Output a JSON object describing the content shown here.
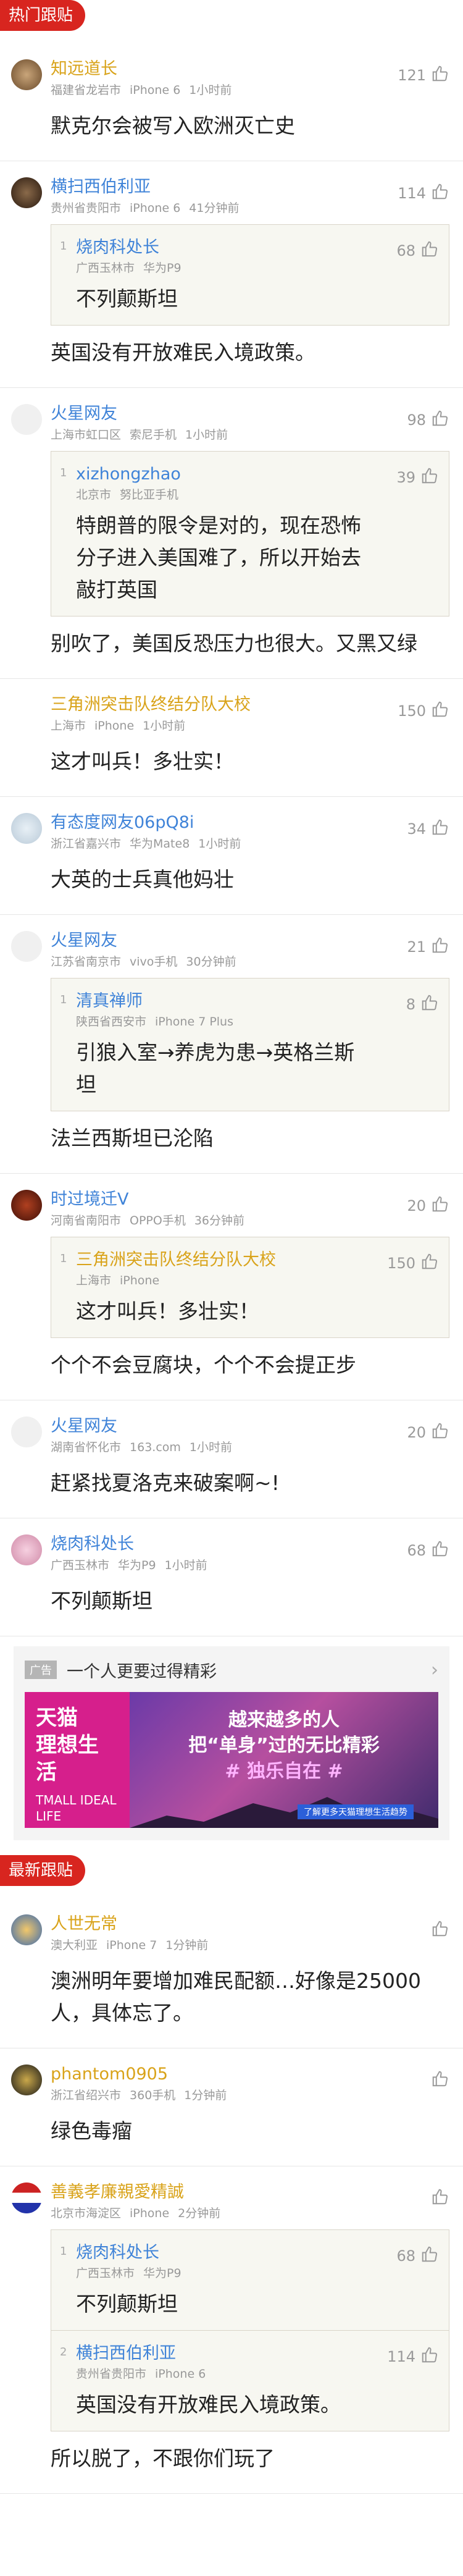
{
  "sections": {
    "hot": "热门跟贴",
    "latest": "最新跟贴"
  },
  "comments": [
    {
      "name": "知远道长",
      "meta": [
        "福建省龙岩市",
        "iPhone 6",
        "1小时前"
      ],
      "likes": "121",
      "text": "默克尔会被写入欧洲灭亡史"
    },
    {
      "name": "横扫西伯利亚",
      "meta": [
        "贵州省贵阳市",
        "iPhone 6",
        "41分钟前"
      ],
      "likes": "114",
      "quote": [
        {
          "num": "1",
          "name": "烧肉科处长",
          "meta": [
            "广西玉林市",
            "华为P9"
          ],
          "likes": "68",
          "text": "不列颠斯坦"
        }
      ],
      "text": "英国没有开放难民入境政策。"
    },
    {
      "name": "火星网友",
      "meta": [
        "上海市虹口区",
        "索尼手机",
        "1小时前"
      ],
      "likes": "98",
      "quote": [
        {
          "num": "1",
          "name": "xizhongzhao",
          "meta": [
            "北京市",
            "努比亚手机"
          ],
          "likes": "39",
          "text": "特朗普的限令是对的，现在恐怖分子进入美国难了，所以开始去敲打英国"
        }
      ],
      "text": "别吹了，美国反恐压力也很大。又黑又绿"
    },
    {
      "name": "三角洲突击队终结分队大校",
      "meta": [
        "上海市",
        "iPhone",
        "1小时前"
      ],
      "likes": "150",
      "text": "这才叫兵！多壮实！"
    },
    {
      "name": "有态度网友06pQ8i",
      "meta": [
        "浙江省嘉兴市",
        "华为Mate8",
        "1小时前"
      ],
      "likes": "34",
      "text": "大英的士兵真他妈壮"
    },
    {
      "name": "火星网友",
      "meta": [
        "江苏省南京市",
        "vivo手机",
        "30分钟前"
      ],
      "likes": "21",
      "quote": [
        {
          "num": "1",
          "name": "清真禅师",
          "meta": [
            "陕西省西安市",
            "iPhone 7 Plus"
          ],
          "likes": "8",
          "text": "引狼入室→养虎为患→英格兰斯坦"
        }
      ],
      "text": "法兰西斯坦已沦陷"
    },
    {
      "name": "时过境迁V",
      "meta": [
        "河南省南阳市",
        "OPPO手机",
        "36分钟前"
      ],
      "likes": "20",
      "quote": [
        {
          "num": "1",
          "name": "三角洲突击队终结分队大校",
          "meta": [
            "上海市",
            "iPhone"
          ],
          "likes": "150",
          "text": "这才叫兵！多壮实！"
        }
      ],
      "text": "个个不会豆腐块，个个不会提正步"
    },
    {
      "name": "火星网友",
      "meta": [
        "湖南省怀化市",
        "163.com",
        "1小时前"
      ],
      "likes": "20",
      "text": "赶紧找夏洛克来破案啊~!"
    },
    {
      "name": "烧肉科处长",
      "meta": [
        "广西玉林市",
        "华为P9",
        "1小时前"
      ],
      "likes": "68",
      "text": "不列颠斯坦"
    }
  ],
  "ad": {
    "tag": "广告",
    "title": "一个人更要过得精彩",
    "left_l1": "天猫\n理想生活",
    "left_l2": "TMALL IDEAL LIFE",
    "r1": "越来越多的人",
    "r2": "把“单身”过的无比精彩",
    "r3": "# 独乐自在 #",
    "r4": "了解更多天猫理想生活趋势"
  },
  "latest": [
    {
      "name": "人世无常",
      "meta": [
        "澳大利亚",
        "iPhone 7",
        "1分钟前"
      ],
      "text": "澳洲明年要增加难民配额…好像是25000人，具体忘了。"
    },
    {
      "name": "phantom0905",
      "meta": [
        "浙江省绍兴市",
        "360手机",
        "1分钟前"
      ],
      "text": "绿色毒瘤"
    },
    {
      "name": "善義孝廉親愛精誠",
      "meta": [
        "北京市海淀区",
        "iPhone",
        "2分钟前"
      ],
      "quote": [
        {
          "num": "1",
          "name": "烧肉科处长",
          "meta": [
            "广西玉林市",
            "华为P9"
          ],
          "likes": "68",
          "text": "不列颠斯坦"
        },
        {
          "num": "2",
          "name": "横扫西伯利亚",
          "meta": [
            "贵州省贵阳市",
            "iPhone 6"
          ],
          "likes": "114",
          "text": "英国没有开放难民入境政策。"
        }
      ],
      "text": "所以脱了，不跟你们玩了"
    }
  ],
  "colors": {
    "accent_red": "#d8251f",
    "name_blue": "#3f83d8",
    "name_gold": "#d9a31a"
  }
}
